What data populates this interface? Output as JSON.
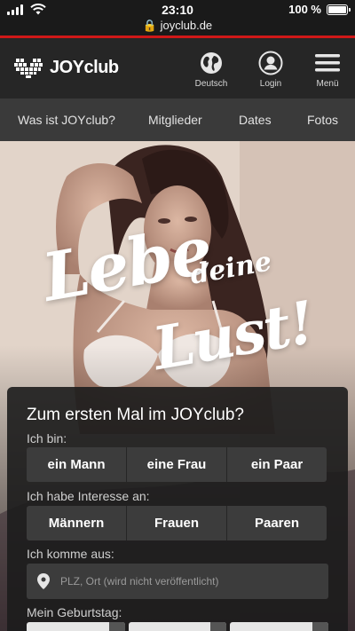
{
  "status_bar": {
    "time": "23:10",
    "url": "joyclub.de",
    "battery": "100 %"
  },
  "header": {
    "logo_text": "JOYclub",
    "language_label": "Deutsch",
    "login_label": "Login",
    "menu_label": "Menü"
  },
  "nav": {
    "items": [
      {
        "label": "Was ist JOYclub?"
      },
      {
        "label": "Mitglieder"
      },
      {
        "label": "Dates"
      },
      {
        "label": "Fotos"
      }
    ]
  },
  "hero": {
    "tagline_1": "Lebe",
    "tagline_2": "deine",
    "tagline_3": "Lust!"
  },
  "signup": {
    "title": "Zum ersten Mal im JOYclub?",
    "i_am_label": "Ich bin:",
    "i_am_options": [
      "ein Mann",
      "eine Frau",
      "ein Paar"
    ],
    "interest_label": "Ich habe Interesse an:",
    "interest_options": [
      "Männern",
      "Frauen",
      "Paaren"
    ],
    "from_label": "Ich komme aus:",
    "location_placeholder": "PLZ, Ort (wird nicht veröffentlicht)",
    "birthday_label": "Mein Geburtstag:"
  },
  "colors": {
    "accent_red": "#d01818",
    "header_bg": "#262626",
    "nav_bg": "#3a3a3a",
    "button_bg": "#3c3c3c"
  }
}
